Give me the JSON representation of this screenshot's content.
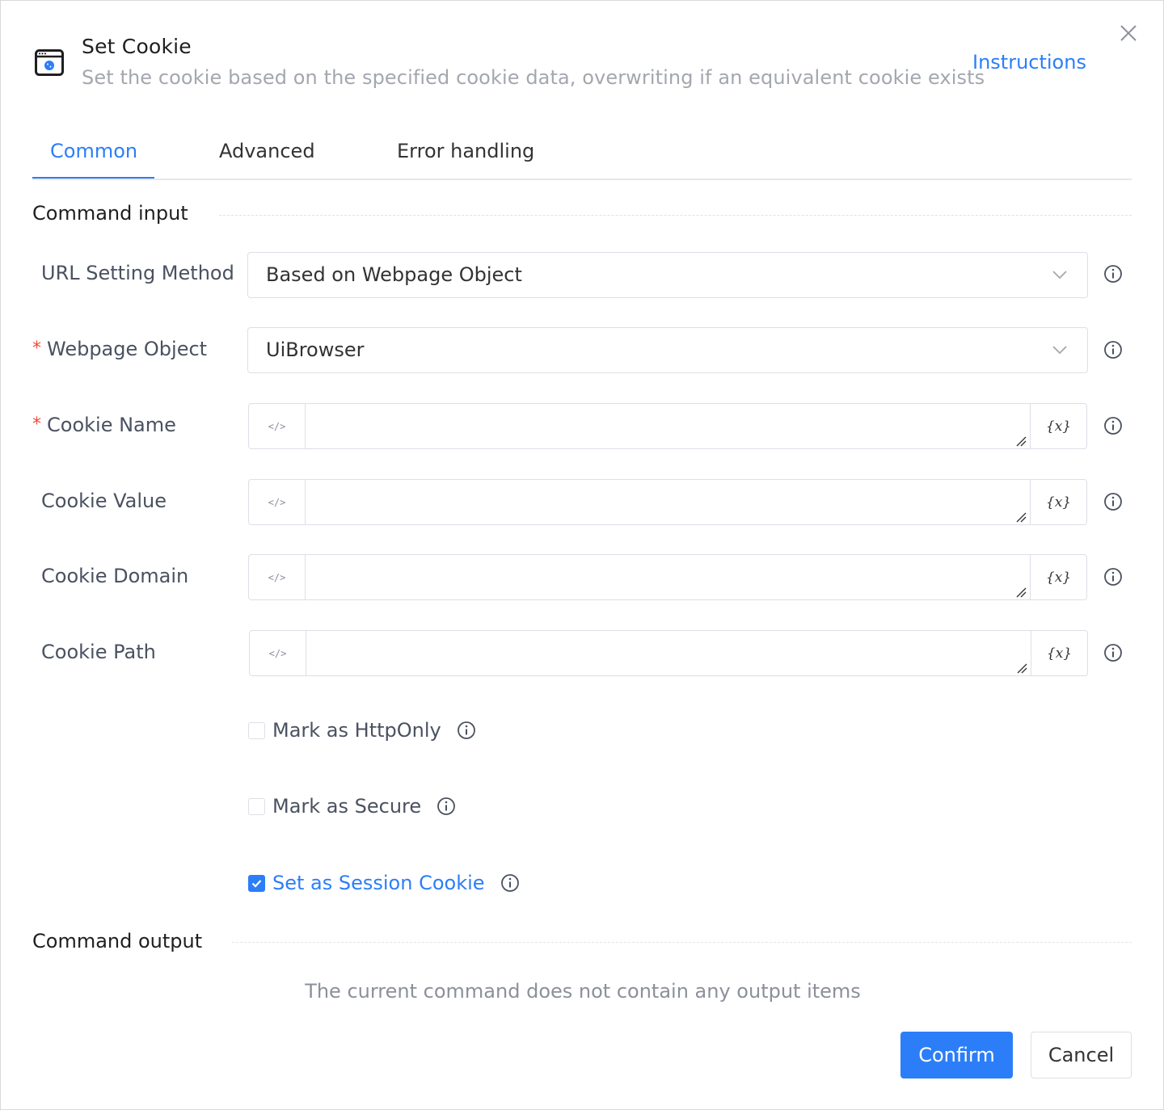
{
  "header": {
    "title": "Set Cookie",
    "subtitle": "Set the cookie based on the specified cookie data, overwriting if an equivalent cookie exists",
    "instructions_link": "Instructions",
    "icon": "browser-cookie-icon",
    "close_icon": "close-icon"
  },
  "tabs": [
    {
      "label": "Common",
      "active": true
    },
    {
      "label": "Advanced",
      "active": false
    },
    {
      "label": "Error handling",
      "active": false
    }
  ],
  "command_input": {
    "section_title": "Command input",
    "url_setting_method": {
      "label": "URL Setting Method",
      "value": "Based on Webpage Object",
      "required": false
    },
    "webpage_object": {
      "label": "Webpage Object",
      "value": "UiBrowser",
      "required": true
    },
    "cookie_name": {
      "label": "Cookie Name",
      "value": "",
      "required": true
    },
    "cookie_value": {
      "label": "Cookie Value",
      "value": "",
      "required": false
    },
    "cookie_domain": {
      "label": "Cookie Domain",
      "value": "",
      "required": false
    },
    "cookie_path": {
      "label": "Cookie Path",
      "value": "",
      "required": false
    },
    "code_prefix_symbol": "</>",
    "variable_button": "{x}",
    "required_marker": "*",
    "checkboxes": [
      {
        "label": "Mark as HttpOnly",
        "checked": false
      },
      {
        "label": "Mark as Secure",
        "checked": false
      },
      {
        "label": "Set as Session Cookie",
        "checked": true
      }
    ]
  },
  "command_output": {
    "section_title": "Command output",
    "empty_message": "The current command does not contain any output items"
  },
  "footer": {
    "confirm_label": "Confirm",
    "cancel_label": "Cancel"
  },
  "colors": {
    "accent": "#2c7ef8",
    "required": "#f5483b",
    "muted_text": "#a3a7ae",
    "border": "#dcdfe6"
  }
}
